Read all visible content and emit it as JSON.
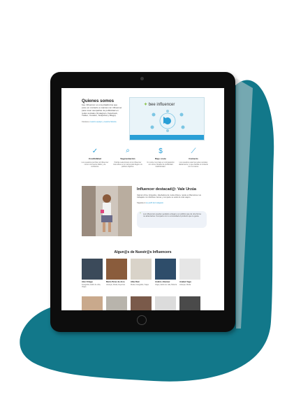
{
  "colors": {
    "teal": "#12788a",
    "accent": "#2a9fd6",
    "bezel": "#0d0d0d"
  },
  "about": {
    "title": "Quienes somos",
    "body": "bee influencer es una plataforma que pone en contacto a marcas con influencer para crear campañas de publicidad en redes sociales (Instagram, Facebook, Twitter, Youtube, Snapchat y Blogs).",
    "cta_prefix": "Conoce a ",
    "cta_link": "nuestro equipo y nuestra historia"
  },
  "video": {
    "logo_text": "bee influencer"
  },
  "features": [
    {
      "icon": "check-icon",
      "glyph": "✓",
      "title": "Credibilidad",
      "desc": "Los usuarios perciben al influencer como una fuente fiable y de confianza."
    },
    {
      "icon": "search-icon",
      "glyph": "⌕",
      "title": "Segmentación",
      "desc": "Podrás seleccionar a los influencer más afines a tu marca para llegar a tu público objetivo."
    },
    {
      "icon": "dollar-icon",
      "glyph": "$",
      "title": "Bajo coste",
      "desc": "Un coste muy bajo en comparación con otros canales de publicidad tradicionales."
    },
    {
      "icon": "chart-icon",
      "glyph": "⟋",
      "title": "Contacto",
      "desc": "Los usuarios usan las redes sociales diariamente, lo que facilita el contacto con tu marca."
    }
  ],
  "featured": {
    "title": "Influencer destacad@: Vale Urzúa",
    "body": "Valeria Urzúa, fotógrafa y diseñadora de moda chilena, reside en Barcelona. Ha trabajado con distintas marcas y comparte su estilo de vida viajero.",
    "followers_prefix": "Síguela en ",
    "followers_link": "su perfil de Instagram",
    "quote": "Los influencers pueden ayudarte a llegar a un público que de otra forma no alcanzarías. Comparte con tu comunidad el producto que te gusta."
  },
  "influencers": {
    "title": "Algun@s de Nuestr@s Influencers",
    "row1": [
      {
        "name": "Alex Ortega",
        "cat": "Fotografía, Estilo de vida, Viajes",
        "bg": "#3b4a5a"
      },
      {
        "name": "Mario Pérez de Arce",
        "cat": "Lifestyle, Moda, Deportes",
        "bg": "#8a5c3c"
      },
      {
        "name": "Alba Ruiz",
        "cat": "Moda, Fotografía, Viajes",
        "bg": "#d9d3c9"
      },
      {
        "name": "Andrés Jiménez",
        "cat": "Viajes, Estilo de vida, Belleza",
        "bg": "#2e4d6a"
      },
      {
        "name": "Anabel Vega",
        "cat": "Lifestyle, Moda",
        "bg": "#e6e6e6"
      }
    ],
    "row2": [
      {
        "bg": "#c9a98c"
      },
      {
        "bg": "#b8b4ac"
      },
      {
        "bg": "#7a5a4a"
      },
      {
        "bg": "#dcdcdc"
      },
      {
        "bg": "#4a4a4a"
      }
    ]
  }
}
